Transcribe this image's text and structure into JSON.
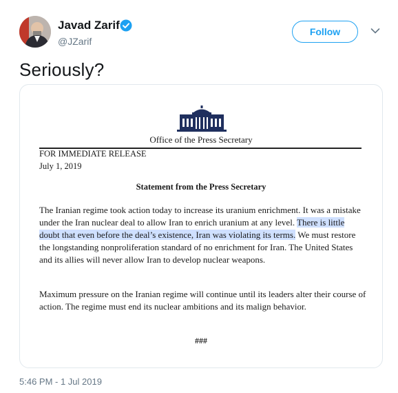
{
  "author": {
    "display_name": "Javad Zarif",
    "handle": "@JZarif",
    "verified": true
  },
  "follow_button": {
    "label": "Follow"
  },
  "tweet": {
    "text": "Seriously?",
    "timestamp": "5:46 PM - 1 Jul 2019"
  },
  "document": {
    "office": "Office of the Press Secretary",
    "release": "FOR IMMEDIATE RELEASE",
    "date": "July 1, 2019",
    "heading": "Statement from the Press Secretary",
    "p1_before": "The Iranian regime took action today to increase its uranium enrichment.  It was a mistake under the Iran nuclear deal to allow Iran to enrich uranium at any level.  ",
    "p1_highlight": "There is little doubt that even before the deal’s existence, Iran was violating its terms.",
    "p1_after": "  We must restore the longstanding nonproliferation standard of no enrichment for Iran.  The United States and its allies will never allow Iran to develop nuclear weapons.",
    "p2": "Maximum pressure on the Iranian regime will continue until its leaders alter their course of action.  The regime must end its nuclear ambitions and its malign behavior.",
    "end_mark": "###"
  },
  "colors": {
    "accent": "#1da1f2",
    "highlight": "#cfe0ff",
    "muted": "#657786"
  },
  "icons": {
    "verified": "verified-badge-icon",
    "menu": "chevron-down-icon",
    "logo": "white-house-icon"
  }
}
